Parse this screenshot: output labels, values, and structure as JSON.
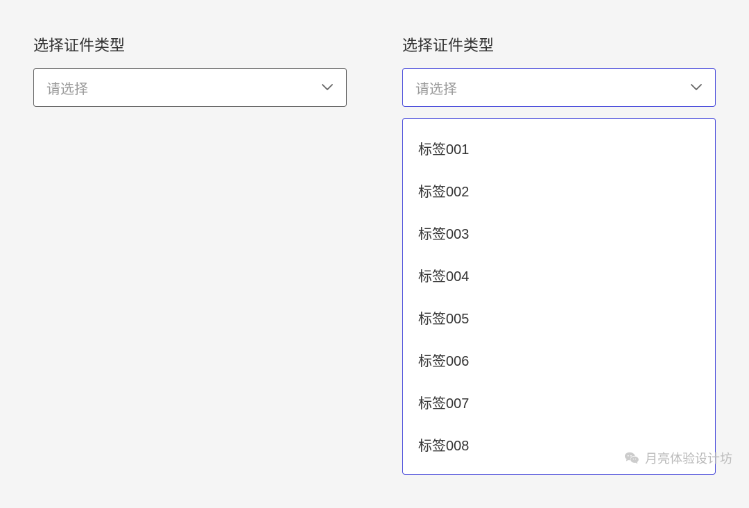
{
  "left": {
    "label": "选择证件类型",
    "placeholder": "请选择"
  },
  "right": {
    "label": "选择证件类型",
    "placeholder": "请选择",
    "options": [
      "标签001",
      "标签002",
      "标签003",
      "标签004",
      "标签005",
      "标签006",
      "标签007",
      "标签008"
    ]
  },
  "watermark": "月亮体验设计坊"
}
